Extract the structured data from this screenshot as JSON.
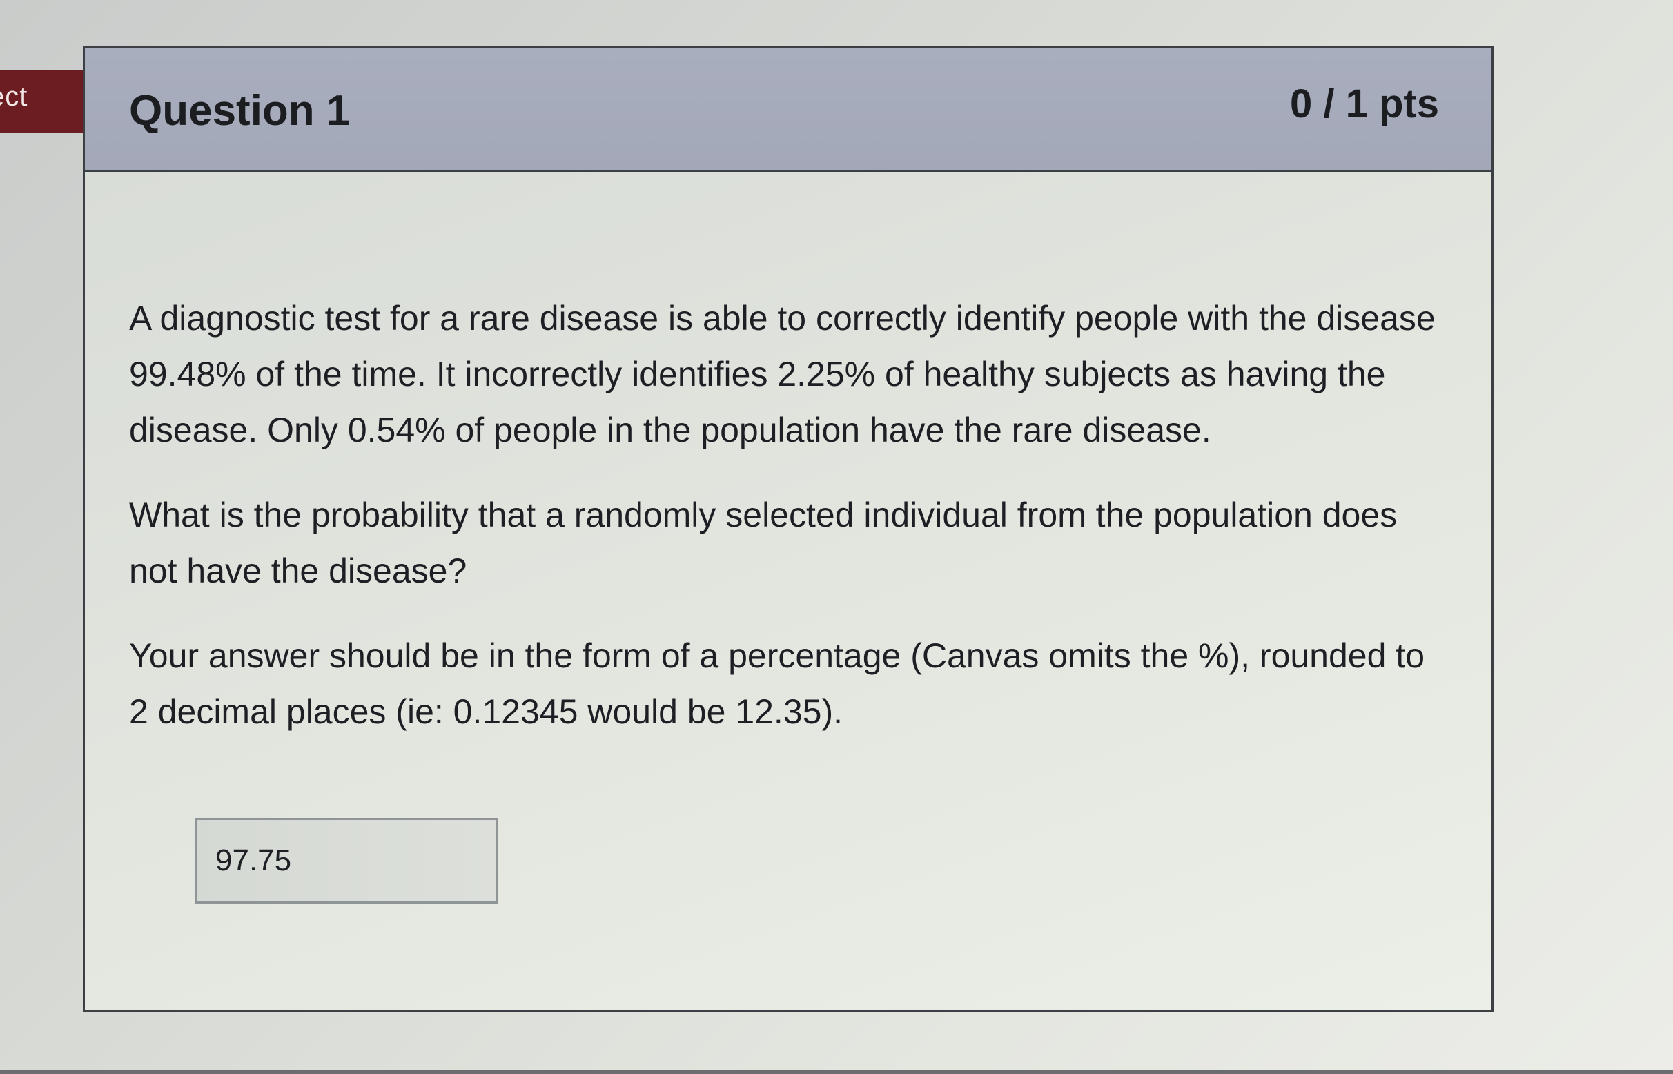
{
  "flag": {
    "label": "ect"
  },
  "question": {
    "title": "Question 1",
    "points": "0 / 1 pts",
    "paragraphs": [
      "A diagnostic test for a rare disease is able to correctly identify people with the disease 99.48% of the time. It incorrectly identifies 2.25% of healthy subjects as having the disease. Only 0.54% of people in the population have the rare disease.",
      "What is the probability that a randomly selected individual from the population does not have the disease?",
      "Your answer should be in the form of a percentage (Canvas omits the %), rounded to 2 decimal places (ie: 0.12345 would be 12.35)."
    ],
    "answer": {
      "value": "97.75"
    }
  },
  "colors": {
    "flag": "#6b1d21",
    "header": "#a7acbc",
    "border": "#3c3f44",
    "text": "#1e1f24"
  }
}
